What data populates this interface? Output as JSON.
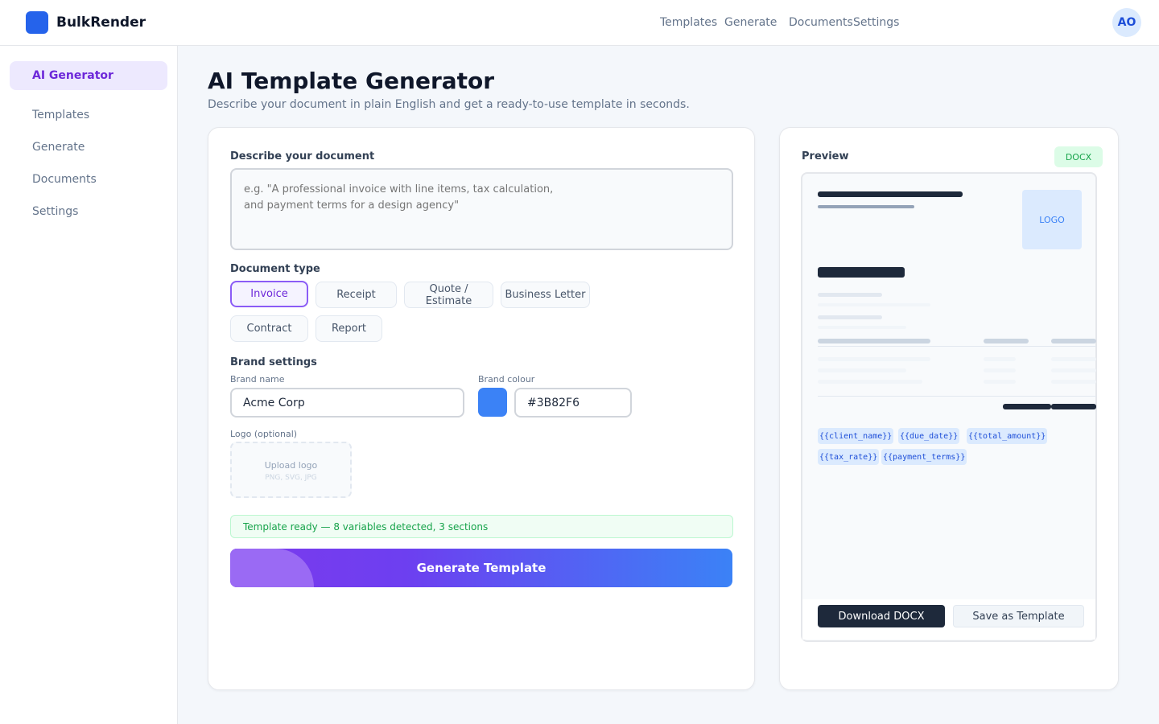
{
  "app": {
    "name": "BulkRender",
    "brand_color": "#2563eb",
    "avatar_initials": "AO"
  },
  "topnav": {
    "items": [
      "Templates",
      "Generate",
      "Documents",
      "Settings"
    ]
  },
  "sidebar": {
    "active": "AI Generator",
    "items": [
      "AI Generator",
      "Templates",
      "Generate",
      "Documents",
      "Settings"
    ]
  },
  "page": {
    "title": "AI Template Generator",
    "subtitle": "Describe your document in plain English and get a ready-to-use template in seconds."
  },
  "form": {
    "describe_label": "Describe your document",
    "describe_placeholder": "e.g. \"A professional invoice with line items, tax calculation,\nand payment terms for a design agency\"",
    "describe_value": "",
    "doctype_label": "Document type",
    "doc_types": [
      "Invoice",
      "Receipt",
      "Quote / Estimate",
      "Business Letter",
      "Contract",
      "Report"
    ],
    "selected_doc_type": "Invoice",
    "brand_settings_label": "Brand settings",
    "brand_name_label": "Brand name",
    "brand_name_value": "Acme Corp",
    "brand_colour_label": "Brand colour",
    "brand_colour_value": "#3B82F6",
    "logo_label": "Logo (optional)",
    "upload_label": "Upload logo",
    "upload_formats": "PNG, SVG, JPG",
    "status_text": "Template ready — 8 variables detected, 3 sections",
    "status_color": "#16a34a",
    "generate_button": "Generate Template",
    "generate_gradient": [
      "#7c3aed",
      "#3b82f6"
    ]
  },
  "preview": {
    "title": "Preview",
    "format_badge": "DOCX",
    "logo_placeholder": "LOGO",
    "variables": [
      "{{client_name}}",
      "{{due_date}}",
      "{{total_amount}}",
      "{{tax_rate}}",
      "{{payment_terms}}"
    ],
    "download_button": "Download DOCX",
    "save_button": "Save as Template"
  }
}
